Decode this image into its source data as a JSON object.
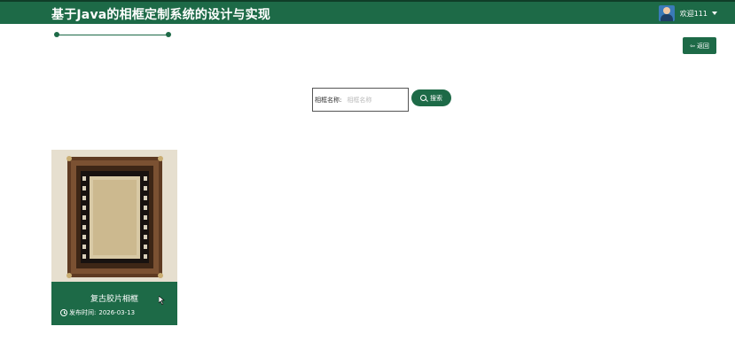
{
  "header": {
    "title": "基于Java的相框定制系统的设计与实现",
    "user_name": "欢迎111"
  },
  "toolbar": {
    "back_label": "返回"
  },
  "search": {
    "label": "相框名称:",
    "placeholder": "相框名称",
    "button_label": "搜索"
  },
  "products": [
    {
      "title": "复古胶片相框",
      "date_label": "发布时间:",
      "date": "2026-03-13"
    }
  ],
  "colors": {
    "primary": "#1d6a47",
    "header_border": "#0f3d28"
  },
  "icons": [
    "avatar",
    "caret-down-icon",
    "arrow-left-icon",
    "search-icon",
    "clock-icon",
    "cursor-icon"
  ]
}
